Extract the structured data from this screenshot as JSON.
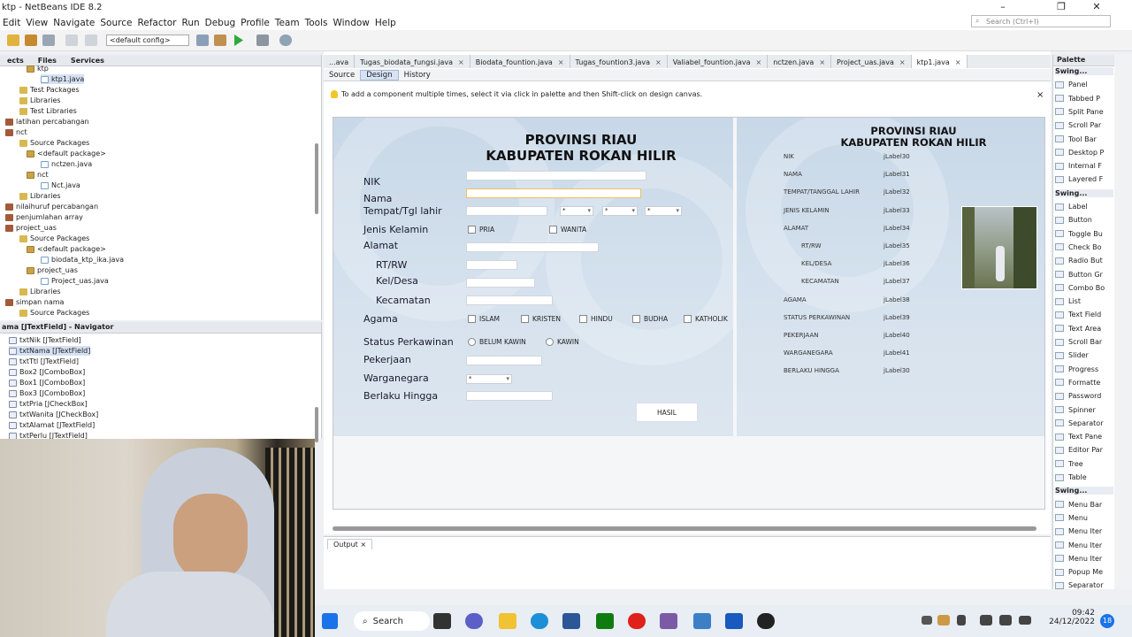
{
  "window": {
    "title": "ktp - NetBeans IDE 8.2",
    "search_placeholder": "Search (Ctrl+I)",
    "minimize": "–",
    "maximize": "❐",
    "close": "✕"
  },
  "menu": [
    "Edit",
    "View",
    "Navigate",
    "Source",
    "Refactor",
    "Run",
    "Debug",
    "Profile",
    "Team",
    "Tools",
    "Window",
    "Help"
  ],
  "toolbar": {
    "config": "<default config>"
  },
  "project_panel": {
    "tabs": [
      "ects",
      "Files",
      "Services"
    ],
    "items": [
      {
        "label": "ktp",
        "indent": 3,
        "icon": "pkg"
      },
      {
        "label": "ktp1.java",
        "indent": 5,
        "icon": "java"
      },
      {
        "label": "Test Packages",
        "indent": 2,
        "icon": "folder"
      },
      {
        "label": "Libraries",
        "indent": 2,
        "icon": "folder"
      },
      {
        "label": "Test Libraries",
        "indent": 2,
        "icon": "folder"
      },
      {
        "label": "latihan percabangan",
        "indent": 0,
        "icon": "proj"
      },
      {
        "label": "nct",
        "indent": 0,
        "icon": "proj"
      },
      {
        "label": "Source Packages",
        "indent": 2,
        "icon": "folder"
      },
      {
        "label": "<default package>",
        "indent": 3,
        "icon": "pkg"
      },
      {
        "label": "nctzen.java",
        "indent": 5,
        "icon": "java"
      },
      {
        "label": "nct",
        "indent": 3,
        "icon": "pkg"
      },
      {
        "label": "Nct.java",
        "indent": 5,
        "icon": "java"
      },
      {
        "label": "Libraries",
        "indent": 2,
        "icon": "folder"
      },
      {
        "label": "nilaihuruf percabangan",
        "indent": 0,
        "icon": "proj"
      },
      {
        "label": "penjumlahan array",
        "indent": 0,
        "icon": "proj"
      },
      {
        "label": "project_uas",
        "indent": 0,
        "icon": "proj"
      },
      {
        "label": "Source Packages",
        "indent": 2,
        "icon": "folder"
      },
      {
        "label": "<default package>",
        "indent": 3,
        "icon": "pkg"
      },
      {
        "label": "biodata_ktp_ika.java",
        "indent": 5,
        "icon": "java"
      },
      {
        "label": "project_uas",
        "indent": 3,
        "icon": "pkg"
      },
      {
        "label": "Project_uas.java",
        "indent": 5,
        "icon": "java"
      },
      {
        "label": "Libraries",
        "indent": 2,
        "icon": "folder"
      },
      {
        "label": "simpan nama",
        "indent": 0,
        "icon": "proj"
      },
      {
        "label": "Source Packages",
        "indent": 2,
        "icon": "folder"
      }
    ]
  },
  "navigator": {
    "title": "ama [JTextField] - Navigator",
    "items": [
      "txtNik [JTextField]",
      "txtNama [JTextField]",
      "txtTtl [JTextField]",
      "Box2 [JComboBox]",
      "Box1 [JComboBox]",
      "Box3 [JComboBox]",
      "txtPria [JCheckBox]",
      "txtWanita [JCheckBox]",
      "txtAlamat [JTextField]",
      "txtPerlu [JTextField]"
    ]
  },
  "editor": {
    "file_tabs": [
      "...ava",
      "Tugas_biodata_fungsi.java",
      "Biodata_fountion.java",
      "Tugas_fountion3.java",
      "Valiabel_fountion.java",
      "nctzen.java",
      "Project_uas.java",
      "ktp1.java"
    ],
    "view_tabs": [
      "Source",
      "Design",
      "History"
    ],
    "active_view": "Design",
    "hint": "To add a component multiple times, select it via click in palette and then Shift-click on design canvas.",
    "hint_close": "×"
  },
  "form": {
    "heading1": "PROVINSI RIAU",
    "heading2": "KABUPATEN ROKAN HILIR",
    "labels": {
      "nik": "NIK",
      "nama": "Nama",
      "ttl": "Tempat/Tgl lahir",
      "jk": "Jenis Kelamin",
      "alamat": "Alamat",
      "rtrw": "RT/RW",
      "keldesa": "Kel/Desa",
      "kecamatan": "Kecamatan",
      "agama": "Agama",
      "status": "Status Perkawinan",
      "pekerjaan": "Pekerjaan",
      "warga": "Warganegara",
      "berlaku": "Berlaku Hingga"
    },
    "combo_placeholder": "*",
    "gender": [
      "PRIA",
      "WANITA"
    ],
    "religions": [
      "ISLAM",
      "KRISTEN",
      "HINDU",
      "BUDHA",
      "KATHOLIK"
    ],
    "marital": [
      "BELUM KAWIN",
      "KAWIN"
    ],
    "button": "HASIL"
  },
  "result": {
    "heading1": "PROVINSI RIAU",
    "heading2": "KABUPATEN ROKAN HILIR",
    "rows": [
      {
        "label": "NIK",
        "value": "jLabel30",
        "indent": 0
      },
      {
        "label": "NAMA",
        "value": "jLabel31",
        "indent": 0
      },
      {
        "label": "TEMPAT/TANGGAL LAHIR",
        "value": "jLabel32",
        "indent": 0
      },
      {
        "label": "JENIS KELAMIN",
        "value": "jLabel33",
        "indent": 0
      },
      {
        "label": "ALAMAT",
        "value": "jLabel34",
        "indent": 0
      },
      {
        "label": "RT/RW",
        "value": "jLabel35",
        "indent": 1
      },
      {
        "label": "KEL/DESA",
        "value": "jLabel36",
        "indent": 1
      },
      {
        "label": "KECAMATAN",
        "value": "jLabel37",
        "indent": 1
      },
      {
        "label": "AGAMA",
        "value": "jLabel38",
        "indent": 0
      },
      {
        "label": "STATUS PERKAWINAN",
        "value": "jLabel39",
        "indent": 0
      },
      {
        "label": "PEKERJAAN",
        "value": "jLabel40",
        "indent": 0
      },
      {
        "label": "WARGANEGARA",
        "value": "jLabel41",
        "indent": 0
      },
      {
        "label": "BERLAKU HINGGA",
        "value": "jLabel30",
        "indent": 0
      }
    ]
  },
  "output": {
    "tab": "Output"
  },
  "palette": {
    "title": "Palette",
    "items": [
      {
        "label": "Swing...",
        "cat": true
      },
      {
        "label": "Panel"
      },
      {
        "label": "Tabbed P"
      },
      {
        "label": "Split Pane"
      },
      {
        "label": "Scroll Par"
      },
      {
        "label": "Tool Bar"
      },
      {
        "label": "Desktop P"
      },
      {
        "label": "Internal F"
      },
      {
        "label": "Layered F"
      },
      {
        "label": "Swing...",
        "cat": true
      },
      {
        "label": "Label"
      },
      {
        "label": "Button"
      },
      {
        "label": "Toggle Bu"
      },
      {
        "label": "Check Bo"
      },
      {
        "label": "Radio But"
      },
      {
        "label": "Button Gr"
      },
      {
        "label": "Combo Bo"
      },
      {
        "label": "List"
      },
      {
        "label": "Text Field"
      },
      {
        "label": "Text Area"
      },
      {
        "label": "Scroll Bar"
      },
      {
        "label": "Slider"
      },
      {
        "label": "Progress"
      },
      {
        "label": "Formatte"
      },
      {
        "label": "Password"
      },
      {
        "label": "Spinner"
      },
      {
        "label": "Separator"
      },
      {
        "label": "Text Pane"
      },
      {
        "label": "Editor Par"
      },
      {
        "label": "Tree"
      },
      {
        "label": "Table"
      },
      {
        "label": "Swing...",
        "cat": true
      },
      {
        "label": "Menu Bar"
      },
      {
        "label": "Menu"
      },
      {
        "label": "Menu Iter"
      },
      {
        "label": "Menu Iter"
      },
      {
        "label": "Menu Iter"
      },
      {
        "label": "Popup Me"
      },
      {
        "label": "Separator"
      }
    ]
  },
  "taskbar": {
    "search": "Search",
    "time": "09:42",
    "date": "24/12/2022",
    "badge": "18"
  }
}
